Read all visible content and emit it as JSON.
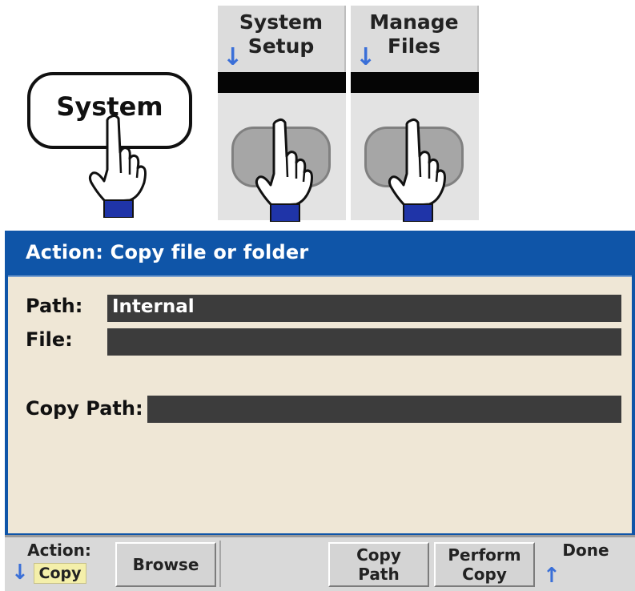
{
  "front_panel": {
    "system_key_label": "System"
  },
  "softkeys_top": [
    {
      "line1": "System",
      "line2": "Setup"
    },
    {
      "line1": "Manage",
      "line2": "Files"
    }
  ],
  "icons": {
    "pointer_hand": "pointing-hand-icon",
    "down_arrow": "↓",
    "up_arrow": "↑"
  },
  "dialog": {
    "title": "Action: Copy file or folder",
    "fields": {
      "path_label": "Path:",
      "path_value": "Internal",
      "file_label": "File:",
      "file_value": "",
      "copy_path_label": "Copy Path:",
      "copy_path_value": ""
    }
  },
  "menu": {
    "action_label": "Action:",
    "action_value": "Copy",
    "browse_label": "Browse",
    "copy_path_line1": "Copy",
    "copy_path_line2": "Path",
    "perform_copy_line1": "Perform",
    "perform_copy_line2": "Copy",
    "done_label": "Done"
  },
  "colors": {
    "title_bar": "#0f55a8",
    "content_bg": "#efe7d6",
    "field_bg": "#3c3c3c",
    "arrow": "#3a6fd8",
    "value_highlight": "#f4efaa"
  }
}
